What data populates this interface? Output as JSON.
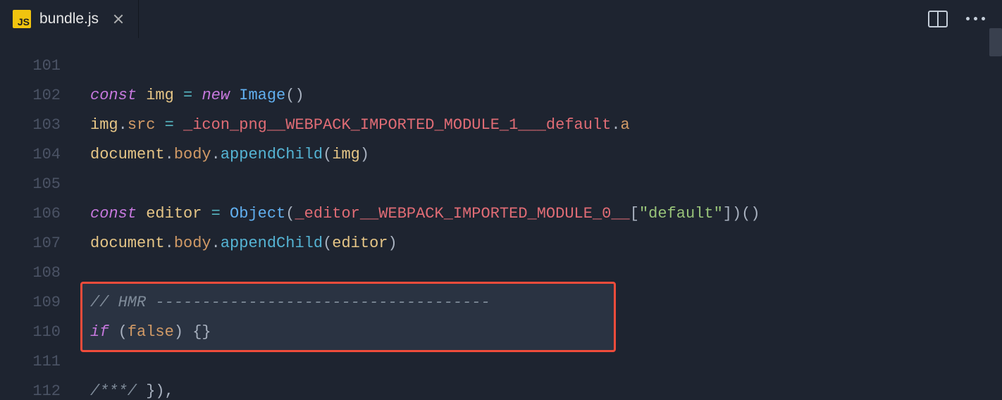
{
  "tab": {
    "icon_label": "JS",
    "filename": "bundle.js"
  },
  "gutter": {
    "lines": [
      "101",
      "102",
      "103",
      "104",
      "105",
      "106",
      "107",
      "108",
      "109",
      "110",
      "111",
      "112"
    ]
  },
  "code": {
    "lines": [
      [],
      [
        {
          "c": "tok-kw",
          "t": "const "
        },
        {
          "c": "tok-var",
          "t": "img"
        },
        {
          "c": "tok-punc",
          "t": " "
        },
        {
          "c": "tok-op",
          "t": "="
        },
        {
          "c": "tok-punc",
          "t": " "
        },
        {
          "c": "tok-kw",
          "t": "new "
        },
        {
          "c": "tok-call",
          "t": "Image"
        },
        {
          "c": "tok-punc",
          "t": "()"
        }
      ],
      [
        {
          "c": "tok-var",
          "t": "img"
        },
        {
          "c": "tok-punc",
          "t": "."
        },
        {
          "c": "tok-prop",
          "t": "src"
        },
        {
          "c": "tok-punc",
          "t": " "
        },
        {
          "c": "tok-op",
          "t": "="
        },
        {
          "c": "tok-punc",
          "t": " "
        },
        {
          "c": "tok-varR",
          "t": "_icon_png__WEBPACK_IMPORTED_MODULE_1___default"
        },
        {
          "c": "tok-punc",
          "t": "."
        },
        {
          "c": "tok-prop",
          "t": "a"
        }
      ],
      [
        {
          "c": "tok-var",
          "t": "document"
        },
        {
          "c": "tok-punc",
          "t": "."
        },
        {
          "c": "tok-prop",
          "t": "body"
        },
        {
          "c": "tok-punc",
          "t": "."
        },
        {
          "c": "tok-fn",
          "t": "appendChild"
        },
        {
          "c": "tok-punc",
          "t": "("
        },
        {
          "c": "tok-var",
          "t": "img"
        },
        {
          "c": "tok-punc",
          "t": ")"
        }
      ],
      [],
      [
        {
          "c": "tok-kw",
          "t": "const "
        },
        {
          "c": "tok-var",
          "t": "editor"
        },
        {
          "c": "tok-punc",
          "t": " "
        },
        {
          "c": "tok-op",
          "t": "="
        },
        {
          "c": "tok-punc",
          "t": " "
        },
        {
          "c": "tok-call",
          "t": "Object"
        },
        {
          "c": "tok-punc",
          "t": "("
        },
        {
          "c": "tok-varR",
          "t": "_editor__WEBPACK_IMPORTED_MODULE_0__"
        },
        {
          "c": "tok-punc",
          "t": "["
        },
        {
          "c": "tok-str",
          "t": "\"default\""
        },
        {
          "c": "tok-punc",
          "t": "])()"
        }
      ],
      [
        {
          "c": "tok-var",
          "t": "document"
        },
        {
          "c": "tok-punc",
          "t": "."
        },
        {
          "c": "tok-prop",
          "t": "body"
        },
        {
          "c": "tok-punc",
          "t": "."
        },
        {
          "c": "tok-fn",
          "t": "appendChild"
        },
        {
          "c": "tok-punc",
          "t": "("
        },
        {
          "c": "tok-var",
          "t": "editor"
        },
        {
          "c": "tok-punc",
          "t": ")"
        }
      ],
      [],
      [
        {
          "c": "tok-cmt",
          "t": "// HMR ------------------------------------"
        }
      ],
      [
        {
          "c": "tok-kw",
          "t": "if "
        },
        {
          "c": "tok-punc",
          "t": "("
        },
        {
          "c": "tok-bool",
          "t": "false"
        },
        {
          "c": "tok-punc",
          "t": ") {}"
        }
      ],
      [],
      [
        {
          "c": "tok-cmt",
          "t": "/***/ "
        },
        {
          "c": "tok-punc",
          "t": "}),"
        }
      ]
    ]
  },
  "highlight": {
    "from_line_index": 8,
    "to_line_index": 9
  }
}
